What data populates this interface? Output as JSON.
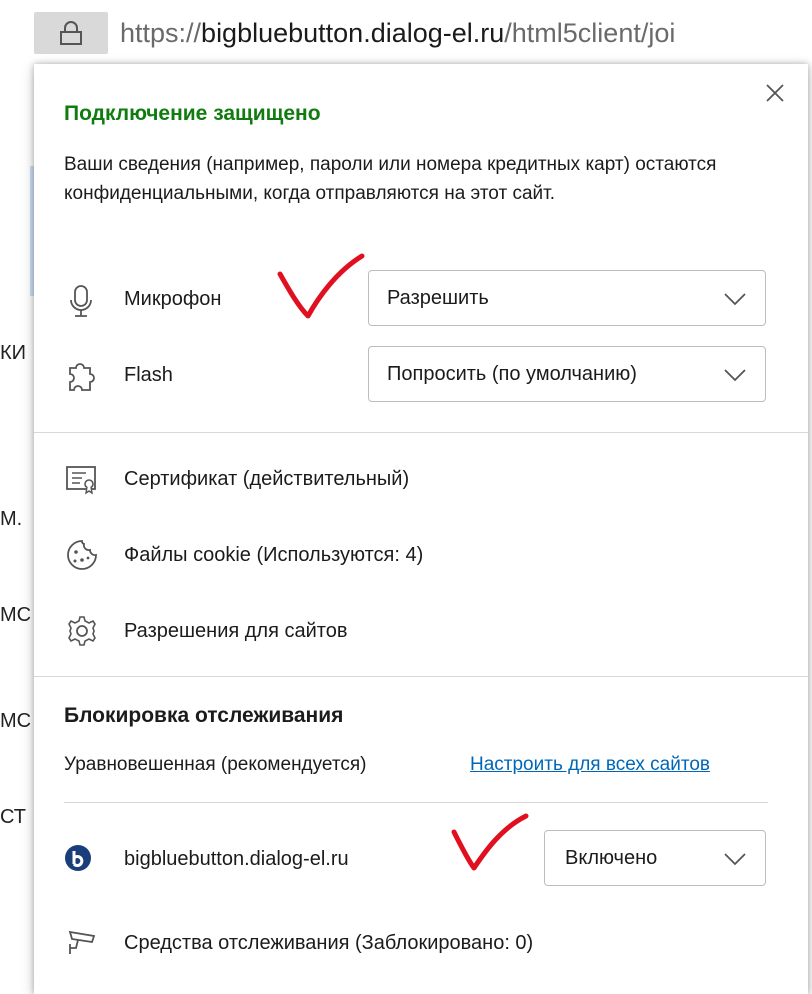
{
  "address_bar": {
    "scheme": "https://",
    "host": "bigbluebutton.dialog-el.ru",
    "path": "/html5client/joi"
  },
  "background_page": {
    "fragments": [
      "КИ",
      "М.",
      "МС",
      "МС",
      "СТ"
    ]
  },
  "flyout": {
    "title": "Подключение защищено",
    "description": "Ваши сведения (например, пароли или номера кредитных карт) остаются конфиденциальными, когда отправляются на этот сайт.",
    "permissions": [
      {
        "label": "Микрофон",
        "value": "Разрешить",
        "icon": "microphone-icon"
      },
      {
        "label": "Flash",
        "value": "Попросить (по умолчанию)",
        "icon": "puzzle-piece-icon"
      }
    ],
    "links": [
      {
        "label": "Сертификат (действительный)",
        "icon": "certificate-icon"
      },
      {
        "label": "Файлы cookie (Используются: 4)",
        "icon": "cookie-icon"
      },
      {
        "label": "Разрешения для сайтов",
        "icon": "gear-icon"
      }
    ],
    "tracking": {
      "title": "Блокировка отслеживания",
      "level": "Уравновешенная (рекомендуется)",
      "configure_link": "Настроить для всех сайтов",
      "site": "bigbluebutton.dialog-el.ru",
      "site_value": "Включено",
      "trackers": "Средства отслеживания (Заблокировано: 0)"
    }
  },
  "colors": {
    "secure_green": "#107c10",
    "link_blue": "#0067b8",
    "annotation_red": "#e01020"
  }
}
